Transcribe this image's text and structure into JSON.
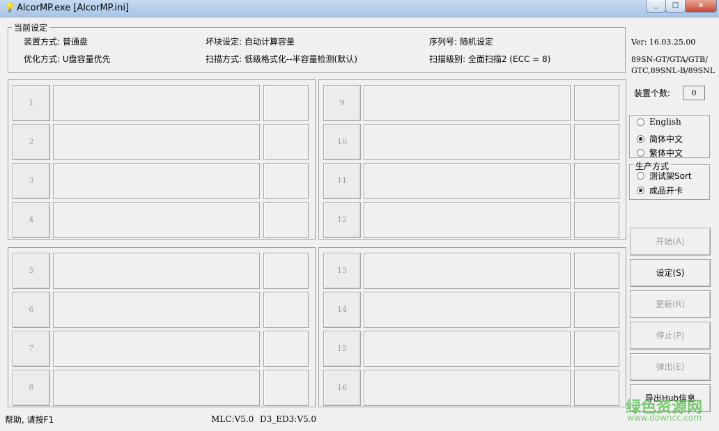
{
  "window": {
    "title": "AlcorMP.exe [AlcorMP.ini]",
    "close": "x",
    "min": "_",
    "max": "□"
  },
  "settings": {
    "legend": "当前设定",
    "mount_mode": "装置方式: 普通盘",
    "bad_block": "坏块设定: 自动计算容量",
    "serial": "序列号: 随机设定",
    "optimize": "优化方式: U盘容量优先",
    "scan_mode": "扫描方式: 低级格式化--半容量检测(默认)",
    "scan_level": "扫描级别: 全面扫描2 (ECC = 8)"
  },
  "slots": [
    "1",
    "2",
    "3",
    "4",
    "5",
    "6",
    "7",
    "8",
    "9",
    "10",
    "11",
    "12",
    "13",
    "14",
    "15",
    "16"
  ],
  "info": {
    "version": "Ver: 16.03.25.00",
    "models_line1": "89SN-GT/GTA/GTB/",
    "models_line2": "GTC,89SNL-B/89SNL",
    "device_count_label": "装置个数:",
    "device_count": "0"
  },
  "language": {
    "english": "English",
    "simplified": "简体中文",
    "traditional": "繁体中文",
    "selected": "simplified"
  },
  "production": {
    "legend": "生产方式",
    "test_rack": "测试架Sort",
    "finished_card": "成品开卡",
    "selected": "finished_card"
  },
  "actions": {
    "start": "开始(A)",
    "settings": "设定(S)",
    "refresh": "更新(R)",
    "stop": "停止(P)",
    "eject": "弹出(E)",
    "export_hub": "导出Hub信息"
  },
  "status": {
    "help": "帮助, 请按F1",
    "mlc": "MLC:V5.0",
    "d3": "D3_ED3:V5.0"
  },
  "watermark": {
    "text": "绿色资源网",
    "url": "www.downcc.com"
  }
}
